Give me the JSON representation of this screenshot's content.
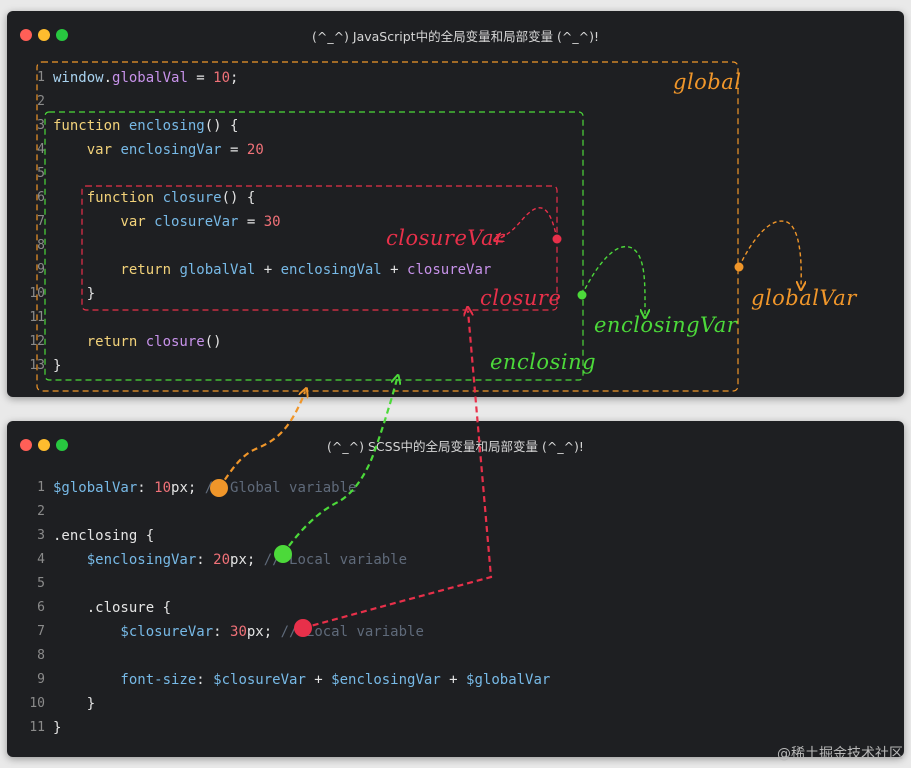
{
  "js_window": {
    "title": "(^_^) JavaScript中的全局变量和局部变量 (^_^)!",
    "lines": [
      {
        "n": "1",
        "tokens": [
          [
            "window",
            "vr"
          ],
          [
            ".",
            "op"
          ],
          [
            "globalVal",
            "pr"
          ],
          [
            " = ",
            "op"
          ],
          [
            "10",
            "num"
          ],
          [
            ";",
            "op"
          ]
        ]
      },
      {
        "n": "2",
        "tokens": []
      },
      {
        "n": "3",
        "tokens": [
          [
            "function ",
            "kw"
          ],
          [
            "enclosing",
            "fn"
          ],
          [
            "() {",
            "op"
          ]
        ]
      },
      {
        "n": "4",
        "tokens": [
          [
            "    var ",
            "kw"
          ],
          [
            "enclosingVar",
            "fn"
          ],
          [
            " = ",
            "op"
          ],
          [
            "20",
            "num"
          ]
        ]
      },
      {
        "n": "5",
        "tokens": []
      },
      {
        "n": "6",
        "tokens": [
          [
            "    function ",
            "kw"
          ],
          [
            "closure",
            "fn"
          ],
          [
            "() {",
            "op"
          ]
        ]
      },
      {
        "n": "7",
        "tokens": [
          [
            "        var ",
            "kw"
          ],
          [
            "closureVar",
            "fn"
          ],
          [
            " = ",
            "op"
          ],
          [
            "30",
            "num"
          ]
        ]
      },
      {
        "n": "8",
        "tokens": []
      },
      {
        "n": "9",
        "tokens": [
          [
            "        return ",
            "kw"
          ],
          [
            "globalVal",
            "fn"
          ],
          [
            " + ",
            "op"
          ],
          [
            "enclosingVal",
            "fn"
          ],
          [
            " + ",
            "op"
          ],
          [
            "closureVar",
            "pr"
          ]
        ]
      },
      {
        "n": "10",
        "tokens": [
          [
            "    }",
            "op"
          ]
        ]
      },
      {
        "n": "11",
        "tokens": []
      },
      {
        "n": "12",
        "tokens": [
          [
            "    return ",
            "kw"
          ],
          [
            "closure",
            "pr"
          ],
          [
            "()",
            "op"
          ]
        ]
      },
      {
        "n": "13",
        "tokens": [
          [
            "}",
            "op"
          ]
        ]
      }
    ]
  },
  "scss_window": {
    "title": "(^_^) SCSS中的全局变量和局部变量 (^_^)!",
    "lines": [
      {
        "n": "1",
        "tokens": [
          [
            "$globalVar",
            "scss-var"
          ],
          [
            ": ",
            "op"
          ],
          [
            "10",
            "num"
          ],
          [
            "px;",
            "unit"
          ],
          [
            " // Global variable",
            "cm"
          ]
        ]
      },
      {
        "n": "2",
        "tokens": []
      },
      {
        "n": "3",
        "tokens": [
          [
            ".enclosing {",
            "sel"
          ]
        ]
      },
      {
        "n": "4",
        "tokens": [
          [
            "    $enclosingVar",
            "scss-var"
          ],
          [
            ": ",
            "op"
          ],
          [
            "20",
            "num"
          ],
          [
            "px;",
            "unit"
          ],
          [
            " // Local variable",
            "cm"
          ]
        ]
      },
      {
        "n": "5",
        "tokens": []
      },
      {
        "n": "6",
        "tokens": [
          [
            "    .closure {",
            "sel"
          ]
        ]
      },
      {
        "n": "7",
        "tokens": [
          [
            "        $closureVar",
            "scss-var"
          ],
          [
            ": ",
            "op"
          ],
          [
            "30",
            "num"
          ],
          [
            "px;",
            "unit"
          ],
          [
            " // Local variable",
            "cm"
          ]
        ]
      },
      {
        "n": "8",
        "tokens": []
      },
      {
        "n": "9",
        "tokens": [
          [
            "        font-size",
            "fn"
          ],
          [
            ": ",
            "op"
          ],
          [
            "$closureVar",
            "scss-var"
          ],
          [
            " + ",
            "op"
          ],
          [
            "$enclosingVar",
            "scss-var"
          ],
          [
            " + ",
            "op"
          ],
          [
            "$globalVar",
            "scss-var"
          ]
        ]
      },
      {
        "n": "10",
        "tokens": [
          [
            "    }",
            "op"
          ]
        ]
      },
      {
        "n": "11",
        "tokens": [
          [
            "}",
            "op"
          ]
        ]
      }
    ]
  },
  "annotations": {
    "global": "global",
    "enclosing": "enclosing",
    "closure": "closure",
    "closure_var": "closureVar",
    "enclosing_var": "enclosingVar",
    "global_var": "globalVar"
  },
  "colors": {
    "global": "#f0962a",
    "enclosing": "#4cd93a",
    "closure": "#e8304a"
  },
  "watermark": "@稀土掘金技术社区"
}
